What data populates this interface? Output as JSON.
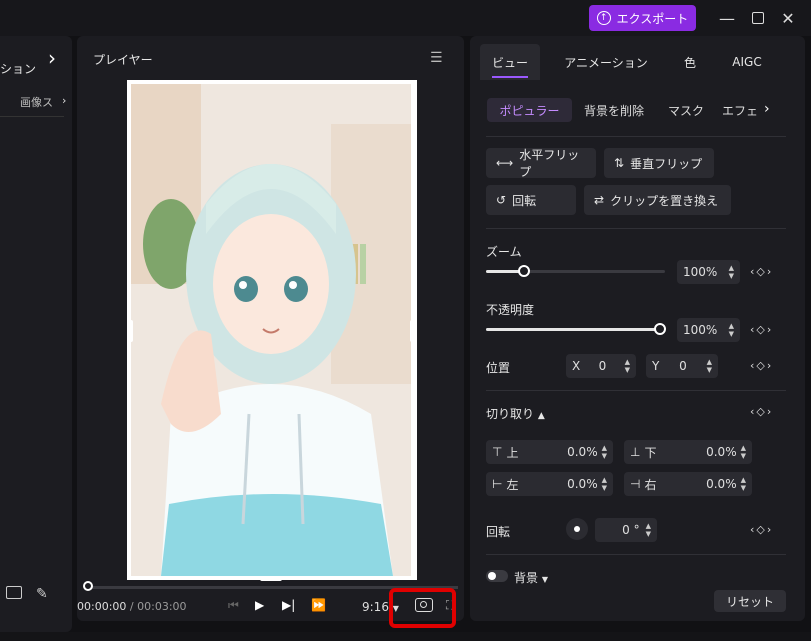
{
  "header": {
    "export_label": "エクスポート"
  },
  "left_panel": {
    "label": "ション",
    "sub_label": "画像ス"
  },
  "player": {
    "title": "プレイヤー",
    "current_time": "00:00:00",
    "separator": "/",
    "total_time": "00:03:00",
    "aspect_ratio": "9:16"
  },
  "props": {
    "tabs": [
      "ビュー",
      "アニメーション",
      "色",
      "AIGC"
    ],
    "subtabs": [
      "ポピュラー",
      "背景を削除",
      "マスク",
      "エフェ"
    ],
    "flip_h": "水平フリップ",
    "flip_v": "垂直フリップ",
    "rotate_btn": "回転",
    "replace_clip": "クリップを置き換え",
    "zoom_label": "ズーム",
    "zoom_value": "100%",
    "zoom_level": 0.19,
    "opacity_label": "不透明度",
    "opacity_value": "100%",
    "opacity_level": 1.0,
    "position_label": "位置",
    "pos_x_label": "X",
    "pos_x_value": "0",
    "pos_y_label": "Y",
    "pos_y_value": "0",
    "crop_label": "切り取り",
    "crop_top_label": "上",
    "crop_top_value": "0.0%",
    "crop_bottom_label": "下",
    "crop_bottom_value": "0.0%",
    "crop_left_label": "左",
    "crop_left_value": "0.0%",
    "crop_right_label": "右",
    "crop_right_value": "0.0%",
    "rotation_label": "回転",
    "rotation_value": "0",
    "rotation_unit": "°",
    "background_label": "背景",
    "reset_label": "リセット"
  },
  "colors": {
    "accent": "#8a2be2",
    "highlight_box": "#e00000"
  }
}
